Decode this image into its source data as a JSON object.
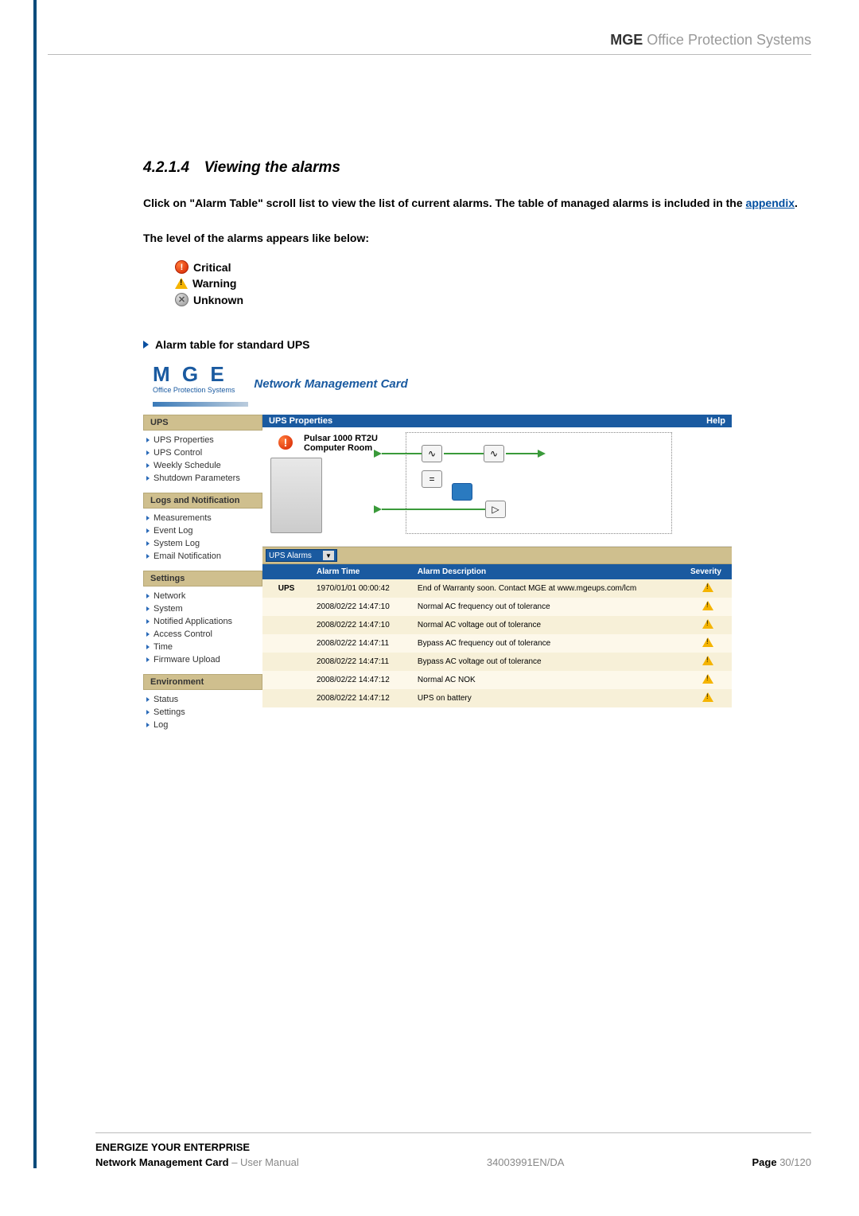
{
  "header": {
    "brand": "MGE",
    "brand_suffix": " Office Protection Systems"
  },
  "section": {
    "number": "4.2.1.4",
    "title": "Viewing the alarms",
    "para1a": "Click on \"Alarm Table\" scroll list to view the list of current alarms. The table of managed alarms is included in the ",
    "appendix": "appendix",
    "para1b": ".",
    "para2": "The level of the alarms appears like below:",
    "levels": {
      "critical": "Critical",
      "warning": "Warning",
      "unknown": "Unknown"
    },
    "subhead": "Alarm table for standard UPS"
  },
  "screenshot": {
    "logo_brand": "M G E",
    "logo_sub": "Office Protection Systems",
    "app_title": "Network  Management  Card",
    "titlebar_left": "UPS Properties",
    "titlebar_right": "Help",
    "device_name": "Pulsar 1000 RT2U",
    "device_loc": "Computer Room",
    "alarm_dropdown": "UPS Alarms",
    "nav": {
      "g1": "UPS",
      "g1_items": [
        "UPS Properties",
        "UPS Control",
        "Weekly Schedule",
        "Shutdown Parameters"
      ],
      "g2": "Logs and Notification",
      "g2_items": [
        "Measurements",
        "Event Log",
        "System Log",
        "Email Notification"
      ],
      "g3": "Settings",
      "g3_items": [
        "Network",
        "System",
        "Notified Applications",
        "Access Control",
        "Time",
        "Firmware Upload"
      ],
      "g4": "Environment",
      "g4_items": [
        "Status",
        "Settings",
        "Log"
      ]
    },
    "table": {
      "headers": {
        "time": "Alarm Time",
        "desc": "Alarm Description",
        "sev": "Severity"
      },
      "ups_label": "UPS",
      "rows": [
        {
          "time": "1970/01/01 00:00:42",
          "desc": "End of Warranty soon. Contact MGE at www.mgeups.com/lcm"
        },
        {
          "time": "2008/02/22 14:47:10",
          "desc": "Normal AC frequency out of tolerance"
        },
        {
          "time": "2008/02/22 14:47:10",
          "desc": "Normal AC voltage out of tolerance"
        },
        {
          "time": "2008/02/22 14:47:11",
          "desc": "Bypass AC frequency out of tolerance"
        },
        {
          "time": "2008/02/22 14:47:11",
          "desc": "Bypass AC voltage out of tolerance"
        },
        {
          "time": "2008/02/22 14:47:12",
          "desc": "Normal AC NOK"
        },
        {
          "time": "2008/02/22 14:47:12",
          "desc": "UPS on battery"
        }
      ]
    }
  },
  "footer": {
    "tagline": "ENERGIZE YOUR ENTERPRISE",
    "doc_title_b": "Network Management Card",
    "doc_title_r": " – User Manual",
    "doc_num": "34003991EN/DA",
    "page_label": "Page ",
    "page_cur": "30",
    "page_total": "/120"
  }
}
